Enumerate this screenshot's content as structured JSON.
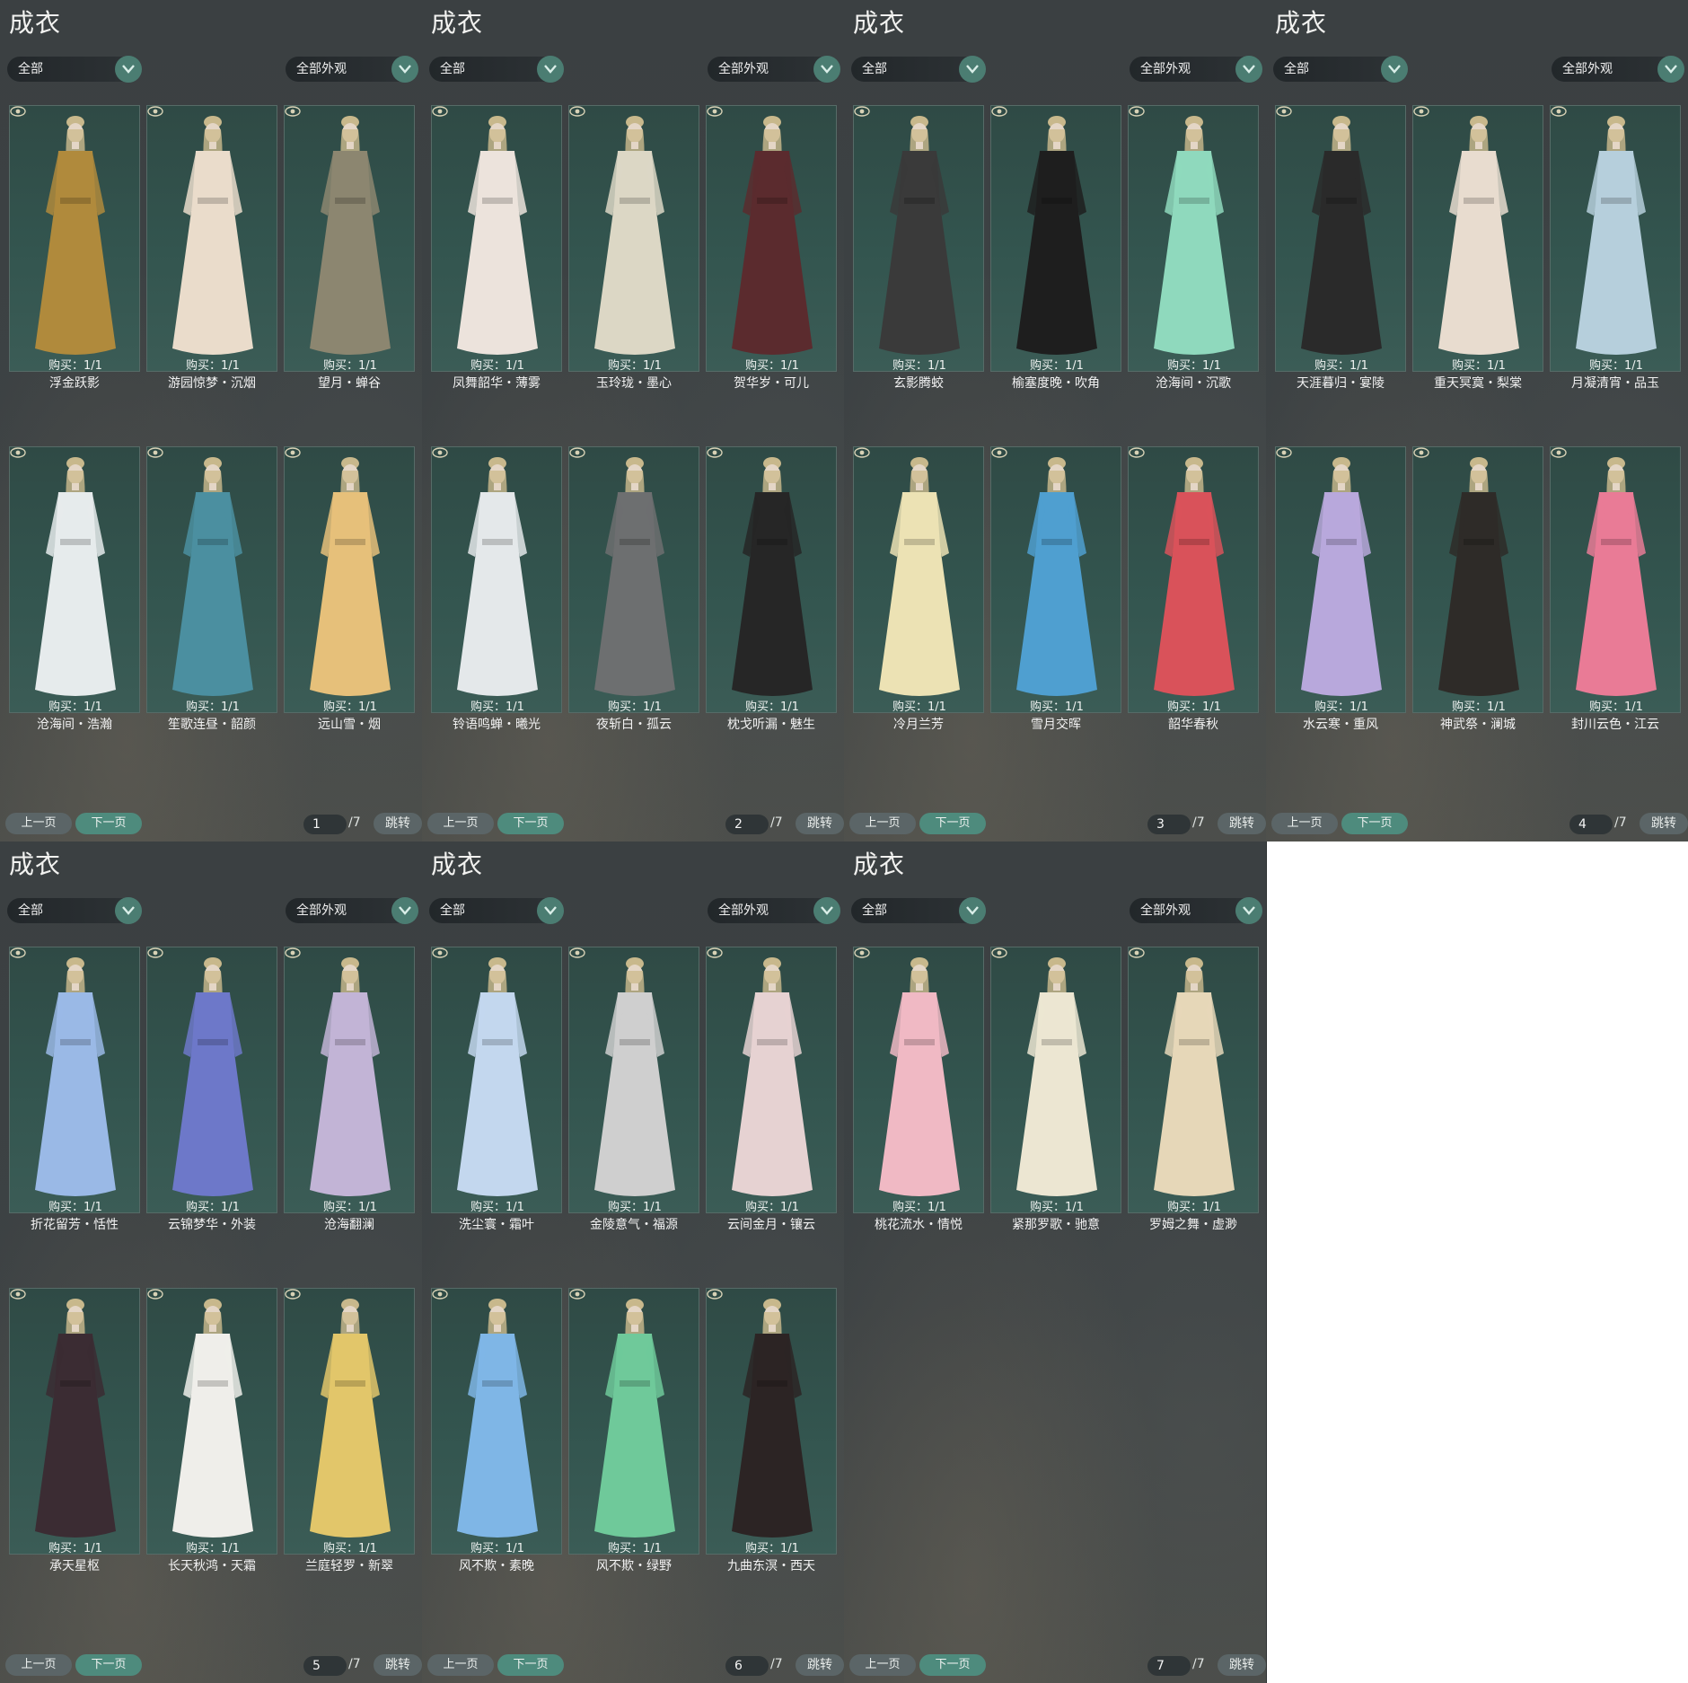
{
  "panels": [
    {
      "title": "成衣",
      "filter_left": "全部",
      "filter_right": "全部外观",
      "page": "1",
      "total": "/7",
      "items": [
        {
          "name": "浮金跃影",
          "buy": "购买：1/1",
          "color": "#b08a3c"
        },
        {
          "name": "游园惊梦・沉烟",
          "buy": "购买：1/1",
          "color": "#eadccb"
        },
        {
          "name": "望月・蝉谷",
          "buy": "购买：1/1",
          "color": "#8c8670"
        },
        {
          "name": "沧海间・浩瀚",
          "buy": "购买：1/1",
          "color": "#e6ebec"
        },
        {
          "name": "笙歌连昼・韶颜",
          "buy": "购买：1/1",
          "color": "#4b8fa0"
        },
        {
          "name": "远山雪・烟",
          "buy": "购买：1/1",
          "color": "#e6c07a"
        }
      ]
    },
    {
      "title": "成衣",
      "filter_left": "全部",
      "filter_right": "全部外观",
      "page": "2",
      "total": "/7",
      "items": [
        {
          "name": "凤舞韶华・薄雾",
          "buy": "购买：1/1",
          "color": "#ece3dc"
        },
        {
          "name": "玉玲珑・墨心",
          "buy": "购买：1/1",
          "color": "#dcd7c5"
        },
        {
          "name": "贺华岁・可儿",
          "buy": "购买：1/1",
          "color": "#5b2b2e"
        },
        {
          "name": "铃语鸣蝉・曦光",
          "buy": "购买：1/1",
          "color": "#e4e8ea"
        },
        {
          "name": "夜斩白・孤云",
          "buy": "购买：1/1",
          "color": "#6d6f70"
        },
        {
          "name": "枕戈听漏・魅生",
          "buy": "购买：1/1",
          "color": "#262626"
        }
      ]
    },
    {
      "title": "成衣",
      "filter_left": "全部",
      "filter_right": "全部外观",
      "page": "3",
      "total": "/7",
      "items": [
        {
          "name": "玄影腾蛟",
          "buy": "购买：1/1",
          "color": "#3a3a3a"
        },
        {
          "name": "榆塞度晚・吹角",
          "buy": "购买：1/1",
          "color": "#1e1e1e"
        },
        {
          "name": "沧海间・沉歌",
          "buy": "购买：1/1",
          "color": "#8fd9bd"
        },
        {
          "name": "冷月兰芳",
          "buy": "购买：1/1",
          "color": "#ece2b4"
        },
        {
          "name": "雪月交晖",
          "buy": "购买：1/1",
          "color": "#4f9fd0"
        },
        {
          "name": "韶华春秋",
          "buy": "购买：1/1",
          "color": "#d9525a"
        }
      ]
    },
    {
      "title": "成衣",
      "filter_left": "全部",
      "filter_right": "全部外观",
      "page": "4",
      "total": "/7",
      "items": [
        {
          "name": "天涯暮归・宴陵",
          "buy": "购买：1/1",
          "color": "#2a2a2a"
        },
        {
          "name": "重天冥寞・梨棠",
          "buy": "购买：1/1",
          "color": "#e8dccf"
        },
        {
          "name": "月凝清宵・品玉",
          "buy": "购买：1/1",
          "color": "#b6cfdc"
        },
        {
          "name": "水云寒・重风",
          "buy": "购买：1/1",
          "color": "#b8a8dc"
        },
        {
          "name": "神武祭・澜城",
          "buy": "购买：1/1",
          "color": "#2e2b28"
        },
        {
          "name": "封川云色・江云",
          "buy": "购买：1/1",
          "color": "#e97b96"
        }
      ]
    },
    {
      "title": "成衣",
      "filter_left": "全部",
      "filter_right": "全部外观",
      "page": "5",
      "total": "/7",
      "items": [
        {
          "name": "折花留芳・恬性",
          "buy": "购买：1/1",
          "color": "#9ab9e6"
        },
        {
          "name": "云锦梦华・外装",
          "buy": "购买：1/1",
          "color": "#6d78c9"
        },
        {
          "name": "沧海翻澜",
          "buy": "购买：1/1",
          "color": "#c2b4d6"
        },
        {
          "name": "承天星枢",
          "buy": "购买：1/1",
          "color": "#3b2c33"
        },
        {
          "name": "长天秋鸿・天霜",
          "buy": "购买：1/1",
          "color": "#efeeea"
        },
        {
          "name": "兰庭轻罗・新翠",
          "buy": "购买：1/1",
          "color": "#e2c66a"
        }
      ]
    },
    {
      "title": "成衣",
      "filter_left": "全部",
      "filter_right": "全部外观",
      "page": "6",
      "total": "/7",
      "items": [
        {
          "name": "洗尘寰・霜叶",
          "buy": "购买：1/1",
          "color": "#c3d7ee"
        },
        {
          "name": "金陵意气・福源",
          "buy": "购买：1/1",
          "color": "#cfcfcf"
        },
        {
          "name": "云间金月・镶云",
          "buy": "购买：1/1",
          "color": "#e6d2d2"
        },
        {
          "name": "风不欺・素晚",
          "buy": "购买：1/1",
          "color": "#7fb6e6"
        },
        {
          "name": "风不欺・绿野",
          "buy": "购买：1/1",
          "color": "#6fc99a"
        },
        {
          "name": "九曲东溟・西天",
          "buy": "购买：1/1",
          "color": "#2c2424"
        }
      ]
    },
    {
      "title": "成衣",
      "filter_left": "全部",
      "filter_right": "全部外观",
      "page": "7",
      "total": "/7",
      "items": [
        {
          "name": "桃花流水・情悦",
          "buy": "购买：1/1",
          "color": "#f0b9c4"
        },
        {
          "name": "紧那罗歌・驰意",
          "buy": "购买：1/1",
          "color": "#ece6d2"
        },
        {
          "name": "罗姆之舞・虚渺",
          "buy": "购买：1/1",
          "color": "#e6d7b8"
        }
      ]
    }
  ],
  "buttons": {
    "prev": "上一页",
    "next": "下一页",
    "jump": "跳转"
  },
  "icons": {
    "dropdown": "chevron-down-icon",
    "preview": "eye-icon"
  },
  "colors": {
    "accent": "#4e8b7d",
    "card_bg": "#2f4a45",
    "panel_bg": "#3b4042"
  }
}
